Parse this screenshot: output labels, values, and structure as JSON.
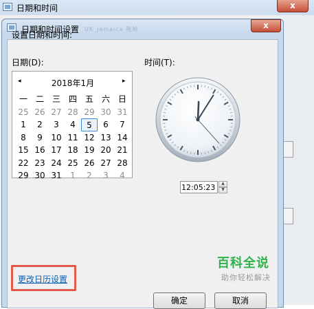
{
  "background_window": {
    "title": "日期和时间",
    "close_label": "x"
  },
  "dialog": {
    "title": "日期和时间设置",
    "title_ghost": "UK_Jamaica 视频",
    "close_label": "x",
    "heading": "设置日期和时间:",
    "date_label": "日期(D):",
    "time_label": "时间(T):"
  },
  "calendar": {
    "month_title": "2018年1月",
    "prev_icon": "◂",
    "next_icon": "▸",
    "weekdays": [
      "一",
      "二",
      "三",
      "四",
      "五",
      "六",
      "日"
    ],
    "days": [
      [
        "25",
        "26",
        "27",
        "28",
        "29",
        "30",
        "31"
      ],
      [
        "1",
        "2",
        "3",
        "4",
        "5",
        "6",
        "7"
      ],
      [
        "8",
        "9",
        "10",
        "11",
        "12",
        "13",
        "14"
      ],
      [
        "15",
        "16",
        "17",
        "18",
        "19",
        "20",
        "21"
      ],
      [
        "22",
        "23",
        "24",
        "25",
        "26",
        "27",
        "28"
      ],
      [
        "29",
        "30",
        "31",
        "1",
        "2",
        "3",
        "4"
      ]
    ],
    "selected_day": "5"
  },
  "clock": {
    "hour": 12,
    "minute": 5,
    "second": 23
  },
  "time_input": {
    "value": "12:05:23"
  },
  "links": {
    "change_calendar": "更改日历设置"
  },
  "buttons": {
    "ok": "确定",
    "cancel": "取消"
  },
  "watermark": {
    "title": "百科全说",
    "subtitle": "助你轻松解决"
  },
  "colors": {
    "highlight": "#e35a4d",
    "link": "#0a5fb4",
    "selection": "#3b8ad9",
    "watermark": "#2fb24e"
  }
}
